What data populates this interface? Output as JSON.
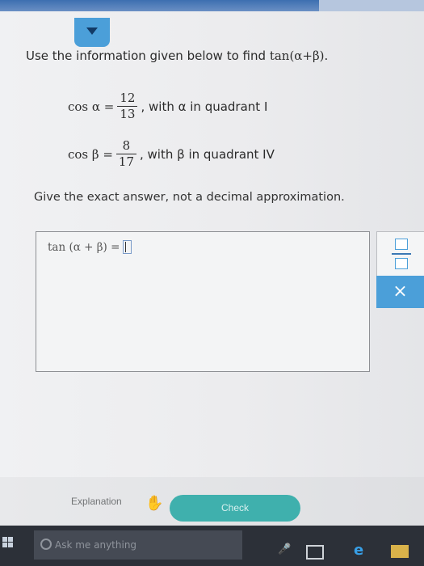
{
  "question": {
    "prompt": "Use the information given below to find",
    "target": "tan(α+β).",
    "cos_alpha": {
      "label": "cos α =",
      "num": "12",
      "den": "13",
      "suffix": ", with α in quadrant I"
    },
    "cos_beta": {
      "label": "cos β =",
      "num": "8",
      "den": "17",
      "suffix": ", with β in quadrant IV"
    },
    "note": "Give the exact answer, not a decimal approximation."
  },
  "answer": {
    "expression": "tan (α + β)  =",
    "value": ""
  },
  "tools": {
    "clear_label": "×"
  },
  "actions": {
    "explanation_label": "Explanation",
    "check_label": "Check"
  },
  "taskbar": {
    "search_placeholder": "Ask me anything"
  },
  "colors": {
    "accent": "#4b9fd9",
    "check": "#3fb0ad",
    "taskbar": "#2c3038"
  }
}
